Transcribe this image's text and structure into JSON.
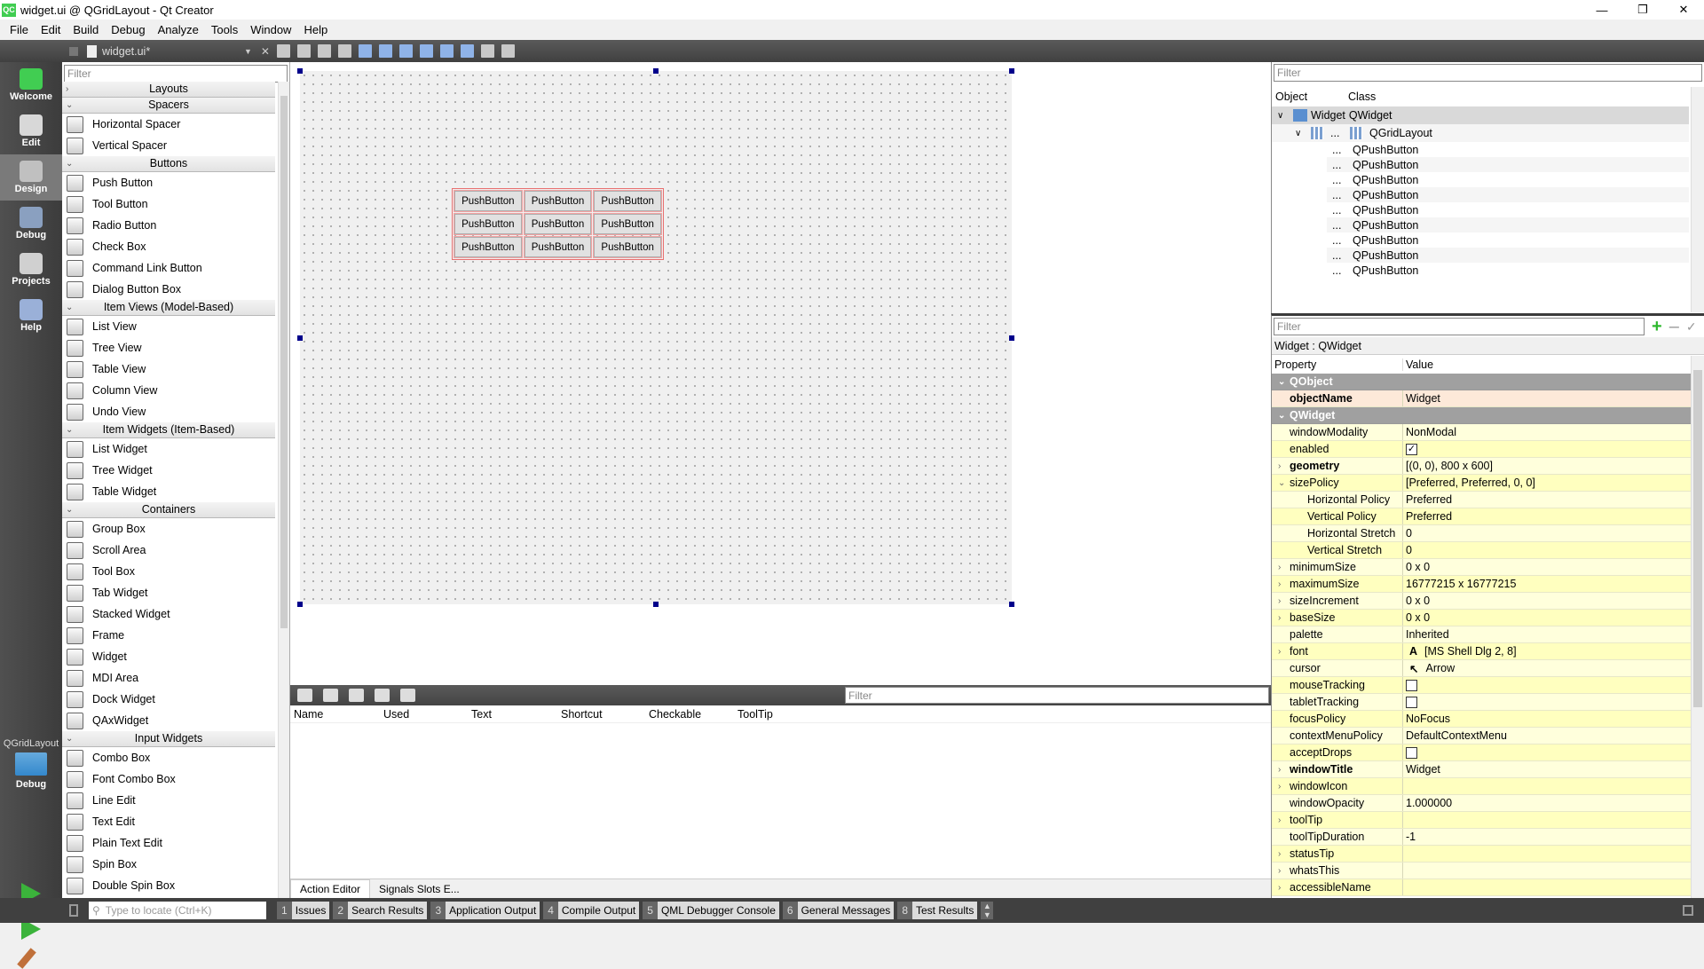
{
  "window": {
    "title": "widget.ui @ QGridLayout - Qt Creator",
    "logo": "QC"
  },
  "menu": [
    "File",
    "Edit",
    "Build",
    "Debug",
    "Analyze",
    "Tools",
    "Window",
    "Help"
  ],
  "editor_toolbar": {
    "document": "widget.ui*"
  },
  "modes": [
    {
      "label": "Welcome",
      "color": "#41cd52"
    },
    {
      "label": "Edit",
      "color": "#d8d8d8"
    },
    {
      "label": "Design",
      "color": "#c0c0c0",
      "active": true
    },
    {
      "label": "Debug",
      "color": "#8aa0c0"
    },
    {
      "label": "Projects",
      "color": "#d0d0d0"
    },
    {
      "label": "Help",
      "color": "#9ab0d8"
    }
  ],
  "kit": {
    "project": "QGridLayout",
    "mode": "Debug"
  },
  "widgetbox": {
    "filter_placeholder": "Filter",
    "groups": [
      {
        "name": "Layouts",
        "collapsed": true,
        "items": []
      },
      {
        "name": "Spacers",
        "items": [
          "Horizontal Spacer",
          "Vertical Spacer"
        ]
      },
      {
        "name": "Buttons",
        "items": [
          "Push Button",
          "Tool Button",
          "Radio Button",
          "Check Box",
          "Command Link Button",
          "Dialog Button Box"
        ]
      },
      {
        "name": "Item Views (Model-Based)",
        "items": [
          "List View",
          "Tree View",
          "Table View",
          "Column View",
          "Undo View"
        ]
      },
      {
        "name": "Item Widgets (Item-Based)",
        "items": [
          "List Widget",
          "Tree Widget",
          "Table Widget"
        ]
      },
      {
        "name": "Containers",
        "items": [
          "Group Box",
          "Scroll Area",
          "Tool Box",
          "Tab Widget",
          "Stacked Widget",
          "Frame",
          "Widget",
          "MDI Area",
          "Dock Widget",
          "QAxWidget"
        ]
      },
      {
        "name": "Input Widgets",
        "items": [
          "Combo Box",
          "Font Combo Box",
          "Line Edit",
          "Text Edit",
          "Plain Text Edit",
          "Spin Box",
          "Double Spin Box"
        ]
      }
    ]
  },
  "form": {
    "buttons": [
      "PushButton",
      "PushButton",
      "PushButton",
      "PushButton",
      "PushButton",
      "PushButton",
      "PushButton",
      "PushButton",
      "PushButton"
    ]
  },
  "action_editor": {
    "filter_placeholder": "Filter",
    "columns": [
      "Name",
      "Used",
      "Text",
      "Shortcut",
      "Checkable",
      "ToolTip"
    ],
    "tabs": [
      "Action Editor",
      "Signals  Slots E..."
    ]
  },
  "object_inspector": {
    "filter_placeholder": "Filter",
    "columns": [
      "Object",
      "Class"
    ],
    "root": {
      "object": "Widget",
      "class": "QWidget"
    },
    "layout": {
      "object": "...",
      "class": "QGridLayout"
    },
    "children": [
      {
        "object": "...",
        "class": "QPushButton"
      },
      {
        "object": "...",
        "class": "QPushButton"
      },
      {
        "object": "...",
        "class": "QPushButton"
      },
      {
        "object": "...",
        "class": "QPushButton"
      },
      {
        "object": "...",
        "class": "QPushButton"
      },
      {
        "object": "...",
        "class": "QPushButton"
      },
      {
        "object": "...",
        "class": "QPushButton"
      },
      {
        "object": "...",
        "class": "QPushButton"
      },
      {
        "object": "...",
        "class": "QPushButton"
      }
    ]
  },
  "property_editor": {
    "filter_placeholder": "Filter",
    "context": "Widget : QWidget",
    "columns": [
      "Property",
      "Value"
    ],
    "rows": [
      {
        "name": "QObject",
        "cat": true
      },
      {
        "name": "objectName",
        "value": "Widget",
        "bold": true,
        "peach": true
      },
      {
        "name": "QWidget",
        "cat": true
      },
      {
        "name": "windowModality",
        "value": "NonModal"
      },
      {
        "name": "enabled",
        "check": true
      },
      {
        "name": "geometry",
        "value": "[(0, 0), 800 x 600]",
        "bold": true,
        "ex": ">"
      },
      {
        "name": "sizePolicy",
        "value": "[Preferred, Preferred, 0, 0]",
        "ex": "v"
      },
      {
        "name": "Horizontal Policy",
        "value": "Preferred",
        "sub": true
      },
      {
        "name": "Vertical Policy",
        "value": "Preferred",
        "sub": true
      },
      {
        "name": "Horizontal Stretch",
        "value": "0",
        "sub": true
      },
      {
        "name": "Vertical Stretch",
        "value": "0",
        "sub": true
      },
      {
        "name": "minimumSize",
        "value": "0 x 0",
        "ex": ">"
      },
      {
        "name": "maximumSize",
        "value": "16777215 x 16777215",
        "ex": ">"
      },
      {
        "name": "sizeIncrement",
        "value": "0 x 0",
        "ex": ">"
      },
      {
        "name": "baseSize",
        "value": "0 x 0",
        "ex": ">"
      },
      {
        "name": "palette",
        "value": "Inherited"
      },
      {
        "name": "font",
        "value": "[MS Shell Dlg 2, 8]",
        "ex": ">",
        "icon": "A"
      },
      {
        "name": "cursor",
        "value": "Arrow",
        "icon": "↖"
      },
      {
        "name": "mouseTracking",
        "check": false
      },
      {
        "name": "tabletTracking",
        "check": false
      },
      {
        "name": "focusPolicy",
        "value": "NoFocus"
      },
      {
        "name": "contextMenuPolicy",
        "value": "DefaultContextMenu"
      },
      {
        "name": "acceptDrops",
        "check": false
      },
      {
        "name": "windowTitle",
        "value": "Widget",
        "bold": true,
        "ex": ">"
      },
      {
        "name": "windowIcon",
        "value": "",
        "ex": ">"
      },
      {
        "name": "windowOpacity",
        "value": "1.000000"
      },
      {
        "name": "toolTip",
        "value": "",
        "ex": ">"
      },
      {
        "name": "toolTipDuration",
        "value": "-1"
      },
      {
        "name": "statusTip",
        "value": "",
        "ex": ">"
      },
      {
        "name": "whatsThis",
        "value": "",
        "ex": ">"
      },
      {
        "name": "accessibleName",
        "value": "",
        "ex": ">"
      }
    ]
  },
  "statusbar": {
    "locate_placeholder": "Type to locate (Ctrl+K)",
    "panes": [
      {
        "n": "1",
        "label": "Issues"
      },
      {
        "n": "2",
        "label": "Search Results"
      },
      {
        "n": "3",
        "label": "Application Output"
      },
      {
        "n": "4",
        "label": "Compile Output"
      },
      {
        "n": "5",
        "label": "QML Debugger Console"
      },
      {
        "n": "6",
        "label": "General Messages"
      },
      {
        "n": "8",
        "label": "Test Results"
      }
    ]
  },
  "colors": {
    "category": "#a0a0a0",
    "property_row": "#ffffbf",
    "property_row_alt": "#ffffdc",
    "peach": "#fde9d9",
    "selection": "#d9d9d9"
  }
}
